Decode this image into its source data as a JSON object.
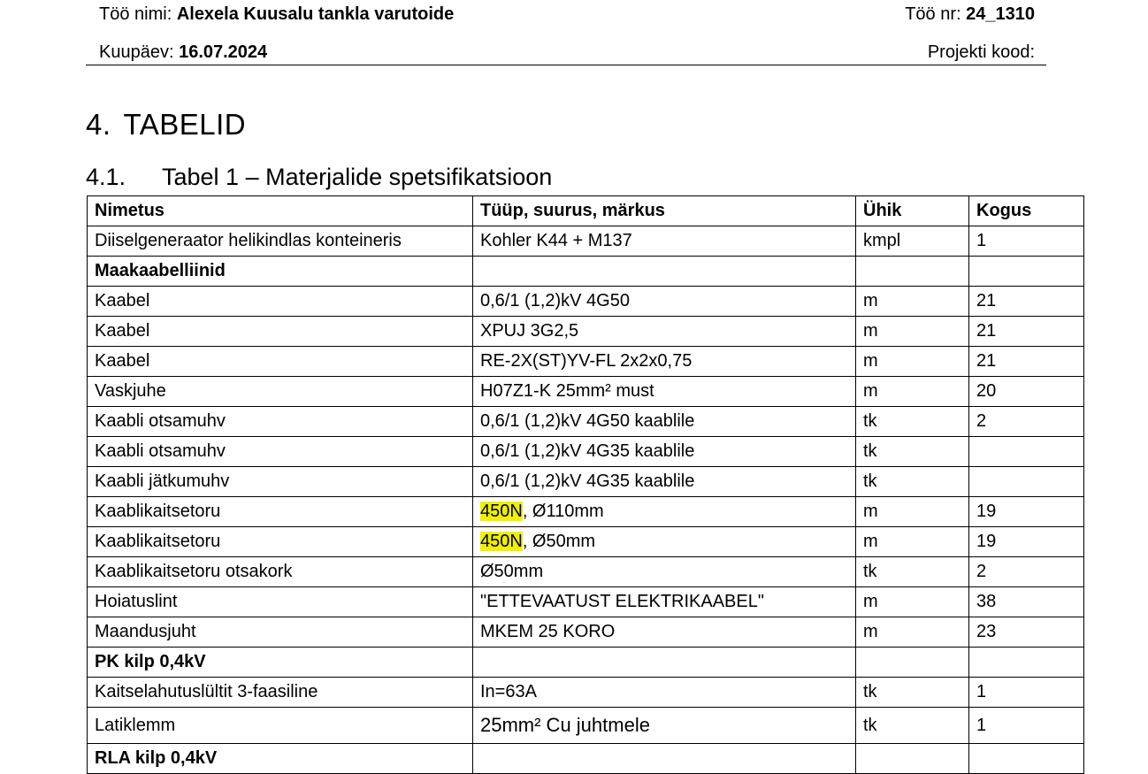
{
  "header": {
    "job_name_label": "Töö nimi:",
    "job_name_value": "Alexela Kuusalu tankla varutoide",
    "job_nr_label": "Töö nr:",
    "job_nr_value": "24_1310",
    "date_label": "Kuupäev:",
    "date_value": "16.07.2024",
    "project_code_label": "Projekti kood:"
  },
  "section": {
    "number": "4.",
    "title": "TABELID"
  },
  "subsection": {
    "number": "4.1.",
    "title": "Tabel 1 – Materjalide spetsifikatsioon"
  },
  "table": {
    "columns": [
      "Nimetus",
      "Tüüp, suurus, märkus",
      "Ühik",
      "Kogus"
    ],
    "rows": [
      {
        "name": "Diiselgeneraator helikindlas konteineris",
        "type": "Kohler K44 + M137",
        "unit": "kmpl",
        "qty": "1"
      },
      {
        "name": "Maakaabelliinid",
        "type": "",
        "unit": "",
        "qty": ""
      },
      {
        "name": "Kaabel",
        "type": "0,6/1 (1,2)kV 4G50",
        "unit": "m",
        "qty": "21"
      },
      {
        "name": "Kaabel",
        "type": "XPUJ 3G2,5",
        "unit": "m",
        "qty": "21"
      },
      {
        "name": "Kaabel",
        "type": "RE-2X(ST)YV-FL 2x2x0,75",
        "unit": "m",
        "qty": "21"
      },
      {
        "name": "Vaskjuhe",
        "type": "H07Z1-K 25mm² must",
        "unit": "m",
        "qty": "20"
      },
      {
        "name": "Kaabli otsamuhv",
        "type": "0,6/1 (1,2)kV 4G50 kaablile",
        "unit": "tk",
        "qty": "2"
      },
      {
        "name": "Kaabli otsamuhv",
        "type": "0,6/1 (1,2)kV 4G35 kaablile",
        "unit": "tk",
        "qty": ""
      },
      {
        "name": "Kaabli jätkumuhv",
        "type": "0,6/1 (1,2)kV 4G35 kaablile",
        "unit": "tk",
        "qty": ""
      },
      {
        "name": "Kaablikaitsetoru",
        "type_highlight": "450N",
        "type_rest": ", Ø110mm",
        "unit": "m",
        "qty": "19"
      },
      {
        "name": "Kaablikaitsetoru",
        "type_highlight": "450N",
        "type_rest": ", Ø50mm",
        "unit": "m",
        "qty": "19"
      },
      {
        "name": "Kaablikaitsetoru otsakork",
        "type": "Ø50mm",
        "unit": "tk",
        "qty": "2"
      },
      {
        "name": "Hoiatuslint",
        "type": "\"ETTEVAATUST ELEKTRIKAABEL\"",
        "unit": "m",
        "qty": "38"
      },
      {
        "name": "Maandusjuht",
        "type": "MKEM 25 KORO",
        "unit": "m",
        "qty": "23"
      },
      {
        "name": "PK kilp 0,4kV",
        "type": "",
        "unit": "",
        "qty": ""
      },
      {
        "name": "Kaitselahutuslültit 3-faasiline",
        "type": "In=63A",
        "unit": "tk",
        "qty": "1"
      },
      {
        "name": "Latiklemm",
        "type": "25mm² Cu juhtmele",
        "unit": "tk",
        "qty": "1"
      },
      {
        "name": "RLA kilp 0,4kV",
        "type": "",
        "unit": "",
        "qty": ""
      }
    ]
  }
}
